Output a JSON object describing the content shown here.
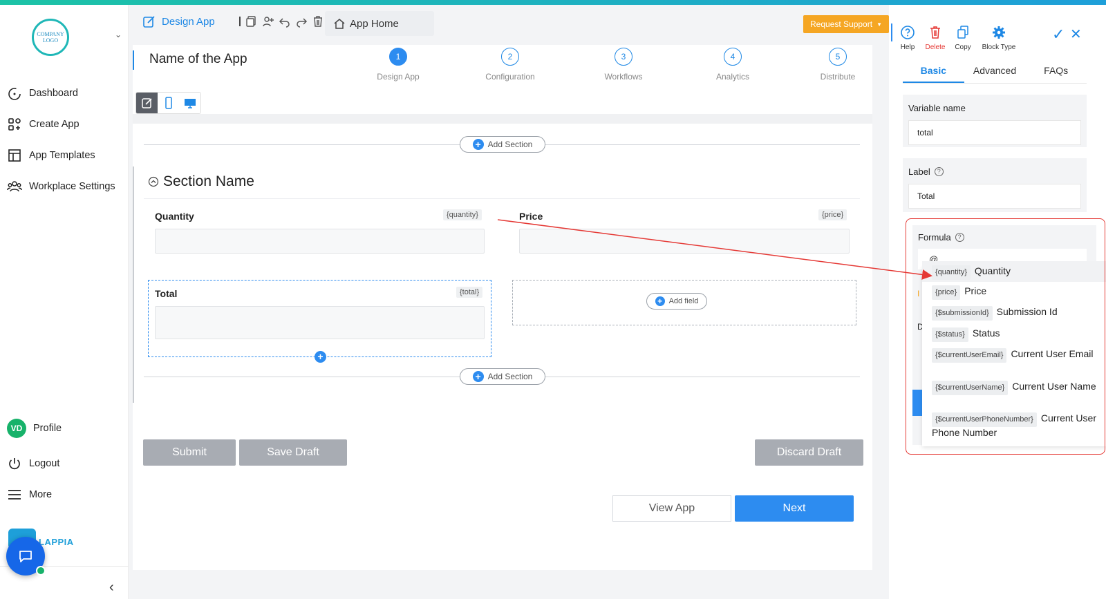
{
  "sidebar": {
    "logo_text": "COMPANY LOGO",
    "items": [
      {
        "label": "Dashboard",
        "icon": "dashboard-icon"
      },
      {
        "label": "Create App",
        "icon": "grid-plus-icon"
      },
      {
        "label": "App Templates",
        "icon": "layout-icon"
      },
      {
        "label": "Workplace Settings",
        "icon": "users-icon"
      }
    ],
    "profile_initials": "VD",
    "profile_label": "Profile",
    "logout_label": "Logout",
    "more_label": "More",
    "brand_text": "LAPPIA"
  },
  "toolbar": {
    "design_label": "Design App",
    "home_label": "App Home",
    "request_support": "Request Support"
  },
  "app": {
    "title": "Name of the App"
  },
  "steps": [
    {
      "num": "1",
      "label": "Design App",
      "active": true
    },
    {
      "num": "2",
      "label": "Configuration",
      "active": false
    },
    {
      "num": "3",
      "label": "Workflows",
      "active": false
    },
    {
      "num": "4",
      "label": "Analytics",
      "active": false
    },
    {
      "num": "5",
      "label": "Distribute",
      "active": false
    }
  ],
  "form": {
    "add_section_label": "Add Section",
    "section_name": "Section Name",
    "fields": [
      {
        "label": "Quantity",
        "tag": "{quantity}"
      },
      {
        "label": "Price",
        "tag": "{price}"
      },
      {
        "label": "Total",
        "tag": "{total}"
      }
    ],
    "add_field_label": "Add field"
  },
  "actions": {
    "submit": "Submit",
    "save_draft": "Save Draft",
    "discard_draft": "Discard Draft",
    "view_app": "View App",
    "next": "Next"
  },
  "panel": {
    "tools": [
      {
        "label": "Help",
        "icon": "help-circle-icon"
      },
      {
        "label": "Delete",
        "icon": "trash-icon"
      },
      {
        "label": "Copy",
        "icon": "copy-icon"
      },
      {
        "label": "Block Type",
        "icon": "gear-icon"
      }
    ],
    "tabs": [
      "Basic",
      "Advanced",
      "FAQs"
    ],
    "variable_name_label": "Variable name",
    "variable_name_value": "total",
    "label_label": "Label",
    "label_value": "Total",
    "formula_label": "Formula",
    "formula_value": "@",
    "suggestions": [
      {
        "tag": "{quantity}",
        "name": "Quantity"
      },
      {
        "tag": "{price}",
        "name": "Price"
      },
      {
        "tag": "{$submissionId}",
        "name": "Submission Id"
      },
      {
        "tag": "{$status}",
        "name": "Status"
      },
      {
        "tag": "{$currentUserEmail}",
        "name": "Current User Email"
      },
      {
        "tag": "{$currentUserName}",
        "name": "Current User Name"
      },
      {
        "tag": "{$currentUserPhoneNumber}",
        "name": "Current User Phone Number"
      }
    ]
  },
  "colors": {
    "accent": "#2d8cf0",
    "warning": "#f5a623",
    "highlight_frame": "#e53935"
  }
}
